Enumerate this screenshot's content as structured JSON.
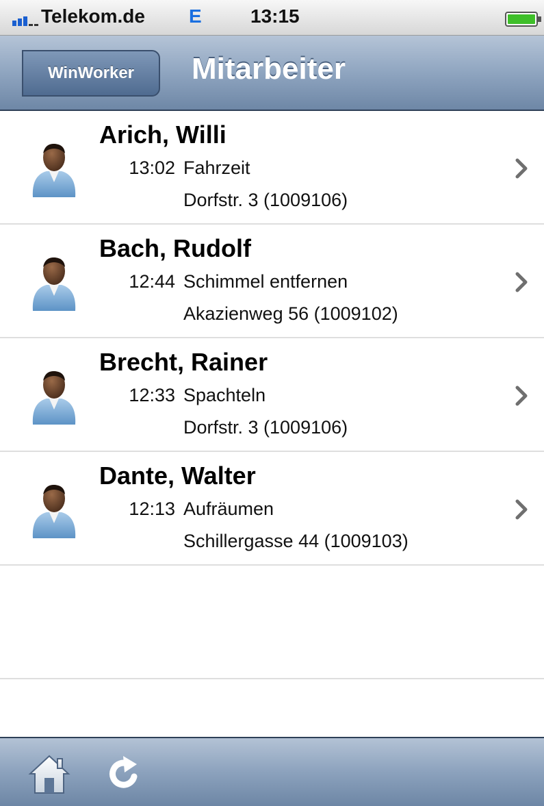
{
  "status_bar": {
    "carrier": "Telekom.de",
    "network": "E",
    "time": "13:15",
    "signal_icon": "signal-bars-icon",
    "battery_icon": "battery-icon"
  },
  "nav": {
    "back_label": "WinWorker",
    "title": "Mitarbeiter"
  },
  "employees": [
    {
      "name": "Arich, Willi",
      "time": "13:02",
      "task": "Fahrzeit",
      "address": "Dorfstr. 3 (1009106)"
    },
    {
      "name": "Bach, Rudolf",
      "time": "12:44",
      "task": "Schimmel entfernen",
      "address": "Akazienweg 56 (1009102)"
    },
    {
      "name": "Brecht, Rainer",
      "time": "12:33",
      "task": "Spachteln",
      "address": "Dorfstr. 3 (1009106)"
    },
    {
      "name": "Dante, Walter",
      "time": "12:13",
      "task": "Aufräumen",
      "address": "Schillergasse 44 (1009103)"
    }
  ],
  "toolbar": {
    "home_icon": "home-icon",
    "refresh_icon": "refresh-icon"
  },
  "colors": {
    "nav_bar": "#8fa5c0",
    "network_indicator": "#1a6fe0",
    "battery": "#3fbf2a"
  }
}
